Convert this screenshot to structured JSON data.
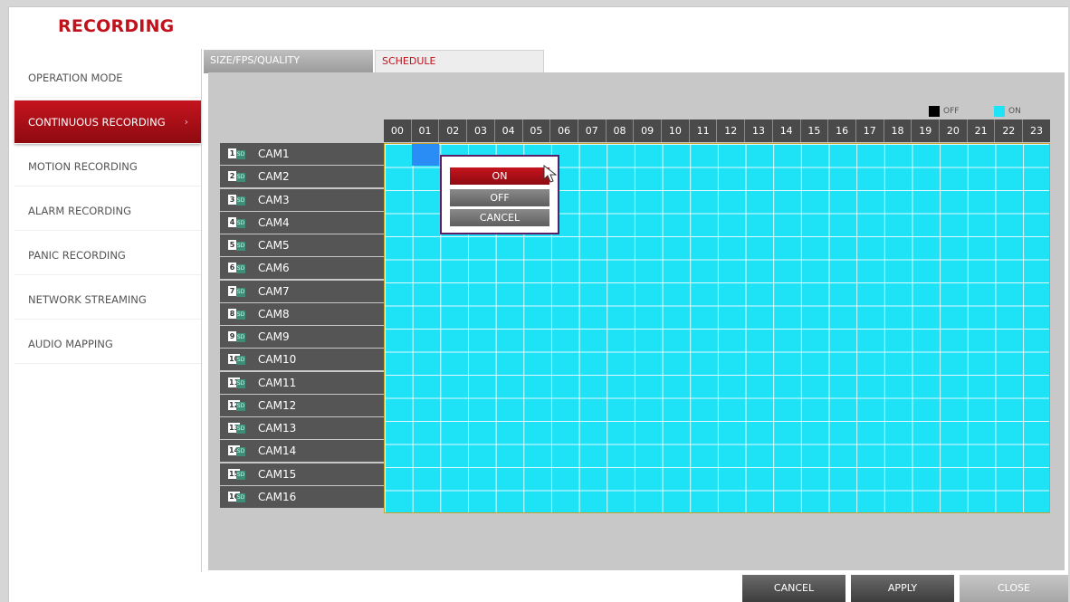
{
  "page": {
    "title": "RECORDING"
  },
  "menu": {
    "items": [
      {
        "label": "OPERATION MODE"
      },
      {
        "label": "CONTINUOUS RECORDING",
        "active": true
      },
      {
        "label": "MOTION RECORDING"
      },
      {
        "label": "ALARM RECORDING"
      },
      {
        "label": "PANIC RECORDING"
      },
      {
        "label": "NETWORK STREAMING"
      },
      {
        "label": "AUDIO MAPPING"
      }
    ],
    "chevron": "›"
  },
  "tabs": [
    {
      "label": "SIZE/FPS/QUALITY",
      "selected": false
    },
    {
      "label": "SCHEDULE",
      "selected": true
    }
  ],
  "legend": {
    "off_label": "OFF",
    "on_label": "ON",
    "off_color": "#000000",
    "on_color": "#1ee2f5"
  },
  "hours": [
    "00",
    "01",
    "02",
    "03",
    "04",
    "05",
    "06",
    "07",
    "08",
    "09",
    "10",
    "11",
    "12",
    "13",
    "14",
    "15",
    "16",
    "17",
    "18",
    "19",
    "20",
    "21",
    "22",
    "23"
  ],
  "cameras": [
    {
      "num": "1",
      "sd": "SD",
      "name": "CAM1"
    },
    {
      "num": "2",
      "sd": "SD",
      "name": "CAM2"
    },
    {
      "num": "3",
      "sd": "SD",
      "name": "CAM3"
    },
    {
      "num": "4",
      "sd": "SD",
      "name": "CAM4"
    },
    {
      "num": "5",
      "sd": "SD",
      "name": "CAM5"
    },
    {
      "num": "6",
      "sd": "SD",
      "name": "CAM6"
    },
    {
      "num": "7",
      "sd": "SD",
      "name": "CAM7"
    },
    {
      "num": "8",
      "sd": "SD",
      "name": "CAM8"
    },
    {
      "num": "9",
      "sd": "SD",
      "name": "CAM9"
    },
    {
      "num": "10",
      "sd": "SD",
      "name": "CAM10"
    },
    {
      "num": "11",
      "sd": "SD",
      "name": "CAM11"
    },
    {
      "num": "12",
      "sd": "SD",
      "name": "CAM12"
    },
    {
      "num": "13",
      "sd": "SD",
      "name": "CAM13"
    },
    {
      "num": "14",
      "sd": "SD",
      "name": "CAM14"
    },
    {
      "num": "15",
      "sd": "SD",
      "name": "CAM15"
    },
    {
      "num": "16",
      "sd": "SD",
      "name": "CAM16"
    }
  ],
  "schedule": {
    "state": "ON",
    "selected_cell": {
      "camera": "CAM1",
      "hour": "01"
    }
  },
  "popup": {
    "on_label": "ON",
    "off_label": "OFF",
    "cancel_label": "CANCEL"
  },
  "footer": {
    "cancel_label": "CANCEL",
    "apply_label": "APPLY",
    "close_label": "CLOSE"
  },
  "colors": {
    "accent": "#c1121c",
    "grid_on": "#1ee2f5",
    "selected_cell": "#2a8cf5"
  }
}
